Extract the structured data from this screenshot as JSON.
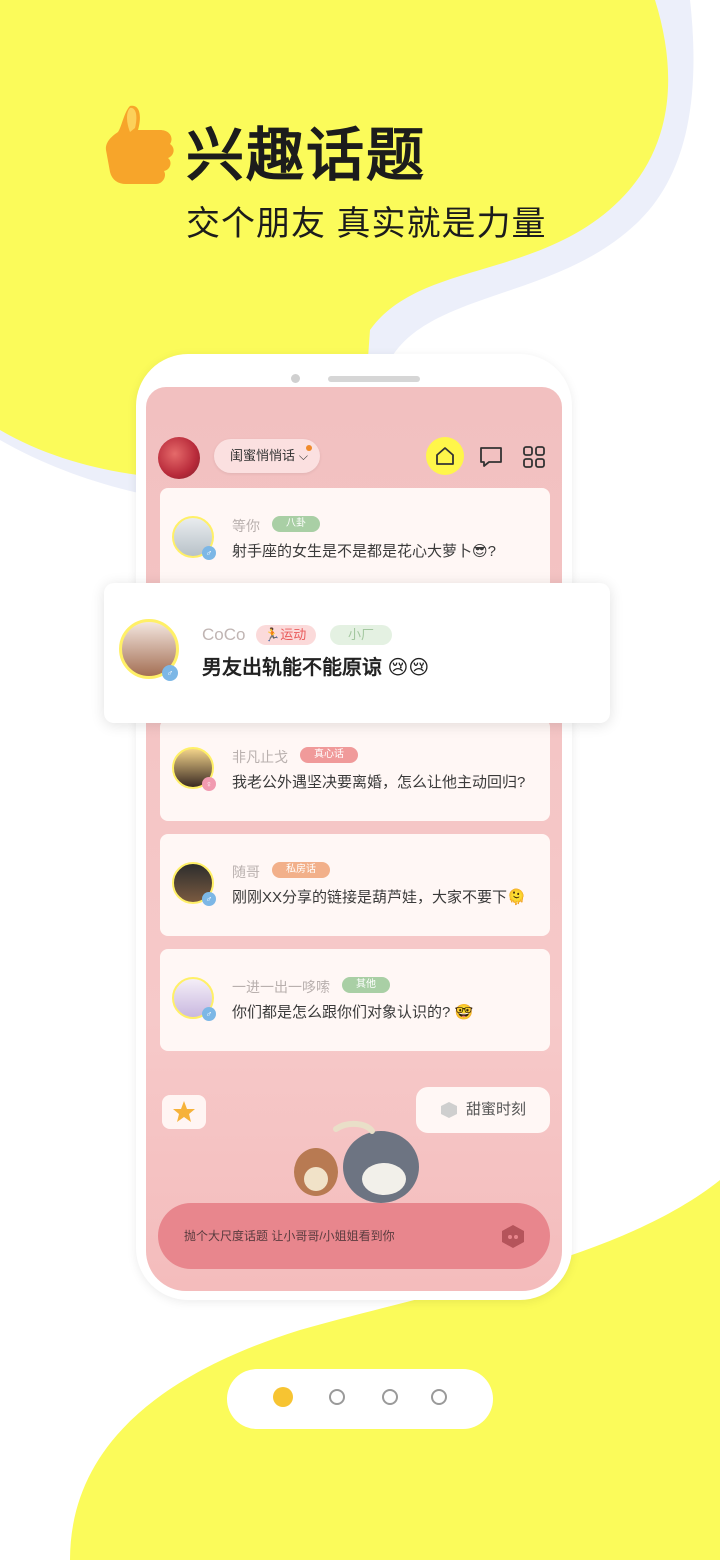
{
  "colors": {
    "accent_yellow": "#fbfb5a",
    "screen_pink": "#f6c9c9",
    "input_pink": "#e8868d",
    "pager_active": "#f7c432"
  },
  "hero": {
    "title": "兴趣话题",
    "subtitle": "交个朋友 真实就是力量",
    "icon": "thumbs-up-icon"
  },
  "app": {
    "channel": "闺蜜悄悄话",
    "header_icons": [
      "home-icon",
      "message-icon",
      "grid-icon"
    ]
  },
  "posts": [
    {
      "user": "等你",
      "tag": "八卦",
      "tag_color": "#a9cfa5",
      "gender": "male",
      "text": "射手座的女生是不是都是花心大萝卜😎?"
    },
    {
      "user": "非凡止戈",
      "tag": "真心话",
      "tag_color": "#f09a9a",
      "gender": "female",
      "text": "我老公外遇坚决要离婚，怎么让他主动回归?"
    },
    {
      "user": "随哥",
      "tag": "私房话",
      "tag_color": "#f2b08a",
      "gender": "male",
      "text": "刚刚XX分享的链接是葫芦娃，大家不要下🫠"
    },
    {
      "user": "一进一出一哆嗦",
      "tag": "其他",
      "tag_color": "#a9cfa5",
      "gender": "male",
      "text": "你们都是怎么跟你们对象认识的? 🤓"
    }
  ],
  "featured": {
    "user": "CoCo",
    "tag1": "运动",
    "tag2": "小厂",
    "text": "男友出轨能不能原谅 😢😢",
    "gender": "male"
  },
  "sweet_button": "甜蜜时刻",
  "input_placeholder": "抛个大尺度话题  让小哥哥/小姐姐看到你",
  "pager": {
    "count": 4,
    "active": 0
  }
}
